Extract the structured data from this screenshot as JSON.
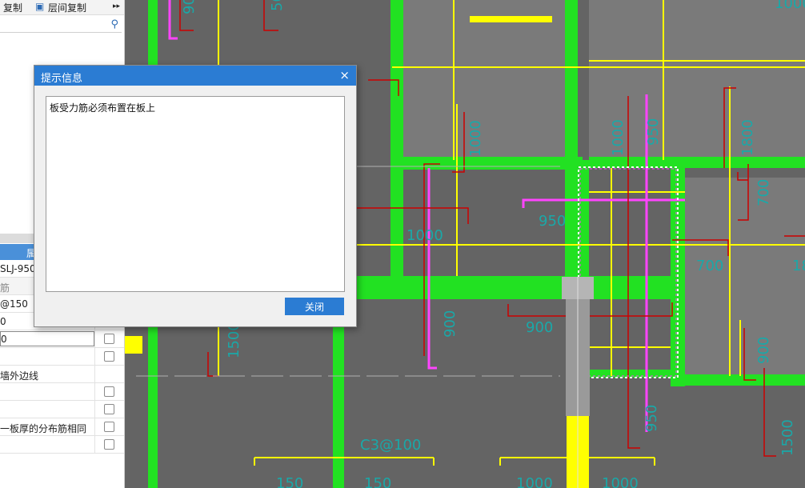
{
  "toolbar": {
    "copy_label": "复制",
    "floor_copy_label": "层间复制",
    "more_label": "▸▸"
  },
  "dialog": {
    "title": "提示信息",
    "message": "板受力筋必须布置在板上",
    "close_button": "关闭",
    "close_icon": "×"
  },
  "prop_table": {
    "header": "属",
    "rows": [
      {
        "value": "SLJ-950",
        "checkbox": false
      },
      {
        "value": "筋",
        "checkbox": false,
        "sub": true
      },
      {
        "value": "@150",
        "checkbox": false
      },
      {
        "value": "0",
        "checkbox": true
      },
      {
        "value": "0",
        "checkbox": true,
        "editing": true
      },
      {
        "value": "",
        "checkbox": true
      },
      {
        "value": "墙外边线",
        "checkbox": false
      },
      {
        "value": "",
        "checkbox": true
      },
      {
        "value": "",
        "checkbox": true
      },
      {
        "value": "一板厚的分布筋相同",
        "checkbox": true
      },
      {
        "value": "",
        "checkbox": true
      }
    ]
  },
  "cad_labels": {
    "l1": "900",
    "l2": "1000",
    "l3": "1000",
    "l4": "950",
    "l5": "900",
    "l6": "1000",
    "l7": "950",
    "l8": "700",
    "l9": "700",
    "l10": "900",
    "l11": "950",
    "l12": "C3@100",
    "l13": "150",
    "l14": "150",
    "l15": "1000",
    "l16": "1000",
    "l17": "1500",
    "l18": "1500",
    "l19": "500",
    "l20": "900",
    "l21": "1800",
    "l22": "1000",
    "l23": "1800"
  },
  "colors": {
    "green": "#22e122",
    "yellow": "#ffff00",
    "magenta": "#ff44ff",
    "red": "#cc0000",
    "dark_bg": "#646464",
    "accent": "#2b7cd3"
  }
}
